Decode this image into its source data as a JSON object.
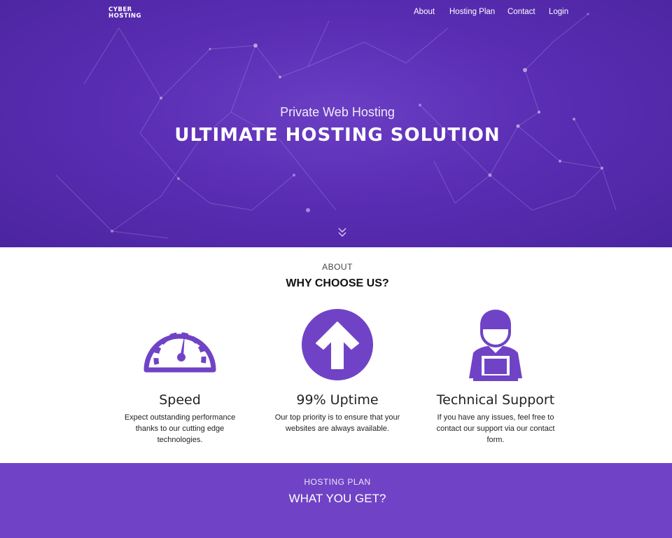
{
  "brand": {
    "line1": "CYBER",
    "line2": "HOSTING"
  },
  "nav": {
    "items": [
      "About",
      "Hosting Plan",
      "Contact",
      "Login"
    ]
  },
  "hero": {
    "subtitle": "Private Web Hosting",
    "title": "ULTIMATE HOSTING SOLUTION",
    "scroll_icon": "double-chevron-down-icon"
  },
  "about": {
    "label": "ABOUT",
    "title": "WHY CHOOSE US?",
    "features": [
      {
        "icon": "speedometer-icon",
        "title": "Speed",
        "text": "Expect outstanding performance thanks to our cutting edge technologies."
      },
      {
        "icon": "arrow-up-circle-icon",
        "title": "99% Uptime",
        "text": "Our top priority is to ensure that your websites are always available."
      },
      {
        "icon": "support-agent-icon",
        "title": "Technical Support",
        "text": "If you have any issues, feel free to contact our support via our contact form."
      }
    ]
  },
  "plan": {
    "label": "HOSTING PLAN",
    "title": "WHAT YOU GET?"
  },
  "colors": {
    "accent": "#7043c6",
    "hero": "#5a2db3",
    "text": "#222222"
  }
}
